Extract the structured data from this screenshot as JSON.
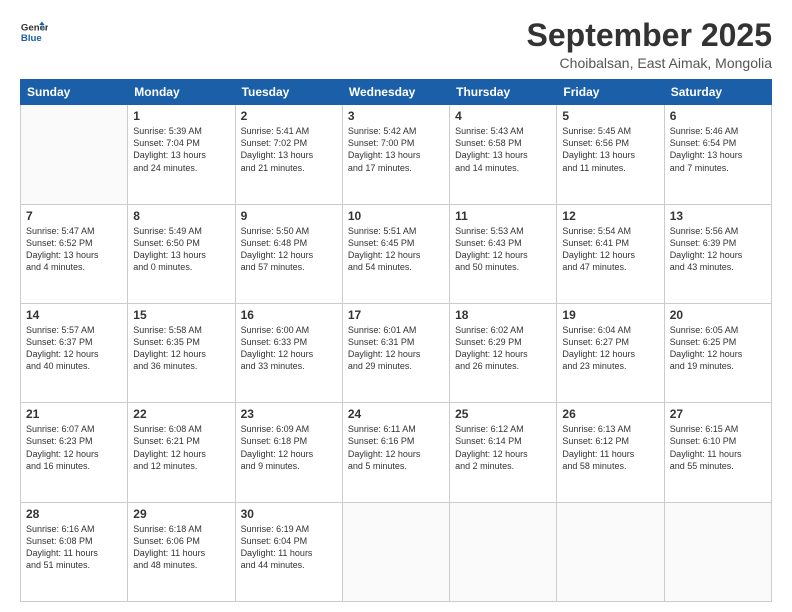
{
  "logo": {
    "line1": "General",
    "line2": "Blue"
  },
  "title": "September 2025",
  "subtitle": "Choibalsan, East Aimak, Mongolia",
  "days_of_week": [
    "Sunday",
    "Monday",
    "Tuesday",
    "Wednesday",
    "Thursday",
    "Friday",
    "Saturday"
  ],
  "weeks": [
    [
      {
        "day": "",
        "info": ""
      },
      {
        "day": "1",
        "info": "Sunrise: 5:39 AM\nSunset: 7:04 PM\nDaylight: 13 hours\nand 24 minutes."
      },
      {
        "day": "2",
        "info": "Sunrise: 5:41 AM\nSunset: 7:02 PM\nDaylight: 13 hours\nand 21 minutes."
      },
      {
        "day": "3",
        "info": "Sunrise: 5:42 AM\nSunset: 7:00 PM\nDaylight: 13 hours\nand 17 minutes."
      },
      {
        "day": "4",
        "info": "Sunrise: 5:43 AM\nSunset: 6:58 PM\nDaylight: 13 hours\nand 14 minutes."
      },
      {
        "day": "5",
        "info": "Sunrise: 5:45 AM\nSunset: 6:56 PM\nDaylight: 13 hours\nand 11 minutes."
      },
      {
        "day": "6",
        "info": "Sunrise: 5:46 AM\nSunset: 6:54 PM\nDaylight: 13 hours\nand 7 minutes."
      }
    ],
    [
      {
        "day": "7",
        "info": "Sunrise: 5:47 AM\nSunset: 6:52 PM\nDaylight: 13 hours\nand 4 minutes."
      },
      {
        "day": "8",
        "info": "Sunrise: 5:49 AM\nSunset: 6:50 PM\nDaylight: 13 hours\nand 0 minutes."
      },
      {
        "day": "9",
        "info": "Sunrise: 5:50 AM\nSunset: 6:48 PM\nDaylight: 12 hours\nand 57 minutes."
      },
      {
        "day": "10",
        "info": "Sunrise: 5:51 AM\nSunset: 6:45 PM\nDaylight: 12 hours\nand 54 minutes."
      },
      {
        "day": "11",
        "info": "Sunrise: 5:53 AM\nSunset: 6:43 PM\nDaylight: 12 hours\nand 50 minutes."
      },
      {
        "day": "12",
        "info": "Sunrise: 5:54 AM\nSunset: 6:41 PM\nDaylight: 12 hours\nand 47 minutes."
      },
      {
        "day": "13",
        "info": "Sunrise: 5:56 AM\nSunset: 6:39 PM\nDaylight: 12 hours\nand 43 minutes."
      }
    ],
    [
      {
        "day": "14",
        "info": "Sunrise: 5:57 AM\nSunset: 6:37 PM\nDaylight: 12 hours\nand 40 minutes."
      },
      {
        "day": "15",
        "info": "Sunrise: 5:58 AM\nSunset: 6:35 PM\nDaylight: 12 hours\nand 36 minutes."
      },
      {
        "day": "16",
        "info": "Sunrise: 6:00 AM\nSunset: 6:33 PM\nDaylight: 12 hours\nand 33 minutes."
      },
      {
        "day": "17",
        "info": "Sunrise: 6:01 AM\nSunset: 6:31 PM\nDaylight: 12 hours\nand 29 minutes."
      },
      {
        "day": "18",
        "info": "Sunrise: 6:02 AM\nSunset: 6:29 PM\nDaylight: 12 hours\nand 26 minutes."
      },
      {
        "day": "19",
        "info": "Sunrise: 6:04 AM\nSunset: 6:27 PM\nDaylight: 12 hours\nand 23 minutes."
      },
      {
        "day": "20",
        "info": "Sunrise: 6:05 AM\nSunset: 6:25 PM\nDaylight: 12 hours\nand 19 minutes."
      }
    ],
    [
      {
        "day": "21",
        "info": "Sunrise: 6:07 AM\nSunset: 6:23 PM\nDaylight: 12 hours\nand 16 minutes."
      },
      {
        "day": "22",
        "info": "Sunrise: 6:08 AM\nSunset: 6:21 PM\nDaylight: 12 hours\nand 12 minutes."
      },
      {
        "day": "23",
        "info": "Sunrise: 6:09 AM\nSunset: 6:18 PM\nDaylight: 12 hours\nand 9 minutes."
      },
      {
        "day": "24",
        "info": "Sunrise: 6:11 AM\nSunset: 6:16 PM\nDaylight: 12 hours\nand 5 minutes."
      },
      {
        "day": "25",
        "info": "Sunrise: 6:12 AM\nSunset: 6:14 PM\nDaylight: 12 hours\nand 2 minutes."
      },
      {
        "day": "26",
        "info": "Sunrise: 6:13 AM\nSunset: 6:12 PM\nDaylight: 11 hours\nand 58 minutes."
      },
      {
        "day": "27",
        "info": "Sunrise: 6:15 AM\nSunset: 6:10 PM\nDaylight: 11 hours\nand 55 minutes."
      }
    ],
    [
      {
        "day": "28",
        "info": "Sunrise: 6:16 AM\nSunset: 6:08 PM\nDaylight: 11 hours\nand 51 minutes."
      },
      {
        "day": "29",
        "info": "Sunrise: 6:18 AM\nSunset: 6:06 PM\nDaylight: 11 hours\nand 48 minutes."
      },
      {
        "day": "30",
        "info": "Sunrise: 6:19 AM\nSunset: 6:04 PM\nDaylight: 11 hours\nand 44 minutes."
      },
      {
        "day": "",
        "info": ""
      },
      {
        "day": "",
        "info": ""
      },
      {
        "day": "",
        "info": ""
      },
      {
        "day": "",
        "info": ""
      }
    ]
  ]
}
